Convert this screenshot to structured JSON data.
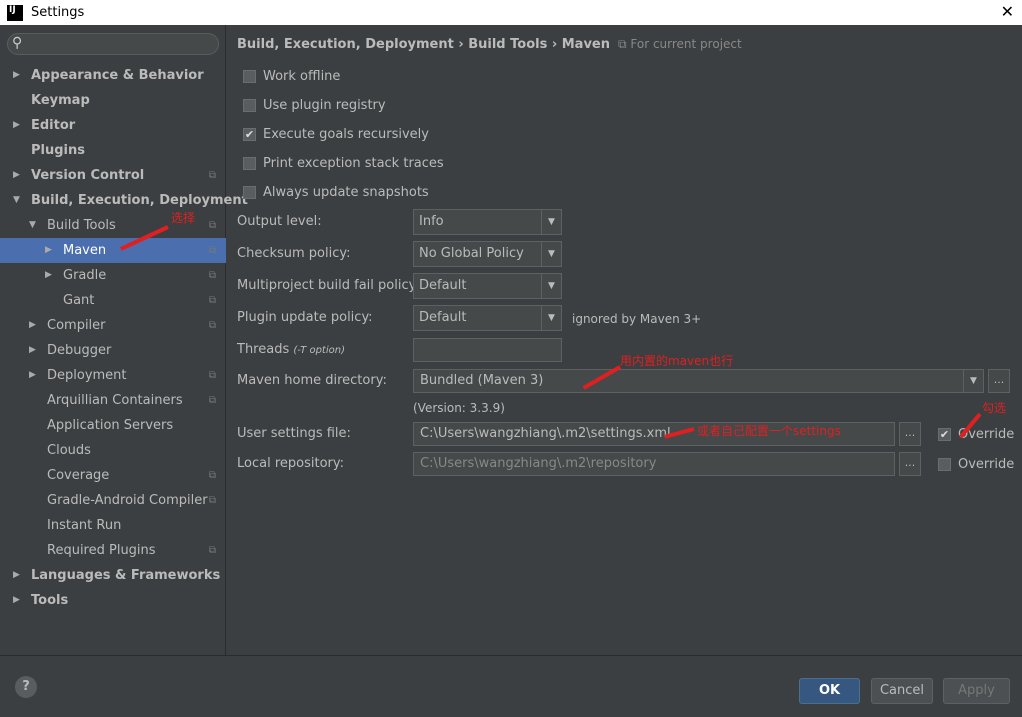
{
  "window": {
    "title": "Settings",
    "logo": "IJ"
  },
  "search": {
    "placeholder": ""
  },
  "sidebar": {
    "items": [
      {
        "label": "Appearance & Behavior",
        "level": 0,
        "arrow": "▶",
        "bold": true
      },
      {
        "label": "Keymap",
        "level": 0,
        "arrow": "",
        "bold": true
      },
      {
        "label": "Editor",
        "level": 0,
        "arrow": "▶",
        "bold": true
      },
      {
        "label": "Plugins",
        "level": 0,
        "arrow": "",
        "bold": true
      },
      {
        "label": "Version Control",
        "level": 0,
        "arrow": "▶",
        "bold": true,
        "proj": true
      },
      {
        "label": "Build, Execution, Deployment",
        "level": 0,
        "arrow": "▼",
        "bold": true
      },
      {
        "label": "Build Tools",
        "level": 1,
        "arrow": "▼",
        "proj": true
      },
      {
        "label": "Maven",
        "level": 2,
        "arrow": "▶",
        "proj": true,
        "selected": true
      },
      {
        "label": "Gradle",
        "level": 2,
        "arrow": "▶",
        "proj": true
      },
      {
        "label": "Gant",
        "level": 2,
        "arrow": "",
        "proj": true
      },
      {
        "label": "Compiler",
        "level": 1,
        "arrow": "▶",
        "proj": true
      },
      {
        "label": "Debugger",
        "level": 1,
        "arrow": "▶"
      },
      {
        "label": "Deployment",
        "level": 1,
        "arrow": "▶",
        "proj": true
      },
      {
        "label": "Arquillian Containers",
        "level": 1,
        "arrow": "",
        "proj": true
      },
      {
        "label": "Application Servers",
        "level": 1,
        "arrow": ""
      },
      {
        "label": "Clouds",
        "level": 1,
        "arrow": ""
      },
      {
        "label": "Coverage",
        "level": 1,
        "arrow": "",
        "proj": true
      },
      {
        "label": "Gradle-Android Compiler",
        "level": 1,
        "arrow": "",
        "proj": true
      },
      {
        "label": "Instant Run",
        "level": 1,
        "arrow": ""
      },
      {
        "label": "Required Plugins",
        "level": 1,
        "arrow": "",
        "proj": true
      },
      {
        "label": "Languages & Frameworks",
        "level": 0,
        "arrow": "▶",
        "bold": true
      },
      {
        "label": "Tools",
        "level": 0,
        "arrow": "▶",
        "bold": true
      }
    ]
  },
  "breadcrumb": {
    "path": "Build, Execution, Deployment › Build Tools › Maven",
    "scope": "For current project"
  },
  "checkboxes": [
    {
      "label": "Work offline",
      "checked": false
    },
    {
      "label": "Use plugin registry",
      "checked": false
    },
    {
      "label": "Execute goals recursively",
      "checked": true
    },
    {
      "label": "Print exception stack traces",
      "checked": false
    },
    {
      "label": "Always update snapshots",
      "checked": false
    }
  ],
  "form": {
    "output_level": {
      "label": "Output level:",
      "value": "Info"
    },
    "checksum": {
      "label": "Checksum policy:",
      "value": "No Global Policy"
    },
    "multiproject": {
      "label": "Multiproject build fail policy:",
      "value": "Default"
    },
    "plugin_update": {
      "label": "Plugin update policy:",
      "value": "Default",
      "hint": "ignored by Maven 3+"
    },
    "threads": {
      "label": "Threads",
      "hint": "(-T option)",
      "value": ""
    },
    "maven_home": {
      "label": "Maven home directory:",
      "value": "Bundled (Maven 3)",
      "version": "(Version: 3.3.9)"
    },
    "user_settings": {
      "label": "User settings file:",
      "value": "C:\\Users\\wangzhiang\\.m2\\settings.xml",
      "override": "Override",
      "override_checked": true
    },
    "local_repo": {
      "label": "Local repository:",
      "value": "C:\\Users\\wangzhiang\\.m2\\repository",
      "override": "Override",
      "override_checked": false
    },
    "browse": "..."
  },
  "annotations": {
    "select": "选择",
    "bundled": "用内置的maven也行",
    "own": "或者自己配置一个settings",
    "check": "勾选"
  },
  "buttons": {
    "help": "?",
    "ok": "OK",
    "cancel": "Cancel",
    "apply": "Apply"
  }
}
